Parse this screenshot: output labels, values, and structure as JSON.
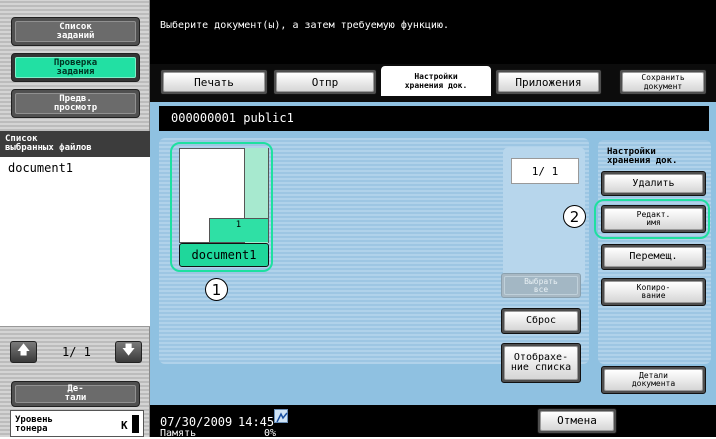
{
  "message": "Выберите документ(ы), а затем требуемую функцию.",
  "left_menu": {
    "job_list": "Список\nзаданий",
    "job_check": "Проверка\nзадания",
    "preview": "Предв.\nпросмотр",
    "selected_header": "Список\nвыбранных файлов",
    "selected_items": [
      "document1"
    ],
    "page_counter": "1/ 1",
    "details": "Де-\nтали",
    "toner_label": "Уровень\nтонера",
    "toner_color": "K"
  },
  "tabs": {
    "print": "Печать",
    "send": "Отпр",
    "storage_settings": "Настройки\nхранения док.",
    "applications": "Приложения",
    "save_document": "Сохранить\nдокумент"
  },
  "path": "000000001  public1",
  "document": {
    "name": "document1",
    "page_count_badge": "1"
  },
  "list_page": "1/  1",
  "buttons": {
    "select_all": "Выбрать\nвсе",
    "reset": "Сброс",
    "list_view": "Отобрахе-\nние списка"
  },
  "storage_section": {
    "title": "Настройки\nхранения док.",
    "delete": "Удалить",
    "edit_name": "Редакт.\nимя",
    "move": "Перемещ.",
    "copy": "Копиро-\nвание",
    "doc_details": "Детали\nдокумента"
  },
  "callouts": {
    "one": "1",
    "two": "2"
  },
  "status": {
    "date": "07/30/2009",
    "time": "14:45",
    "memory_label": "Память",
    "memory_value": "0%"
  },
  "cancel": "Отмена",
  "colors": {
    "accent_green": "#22e0a3",
    "panel_blue": "#8fc1e1"
  }
}
